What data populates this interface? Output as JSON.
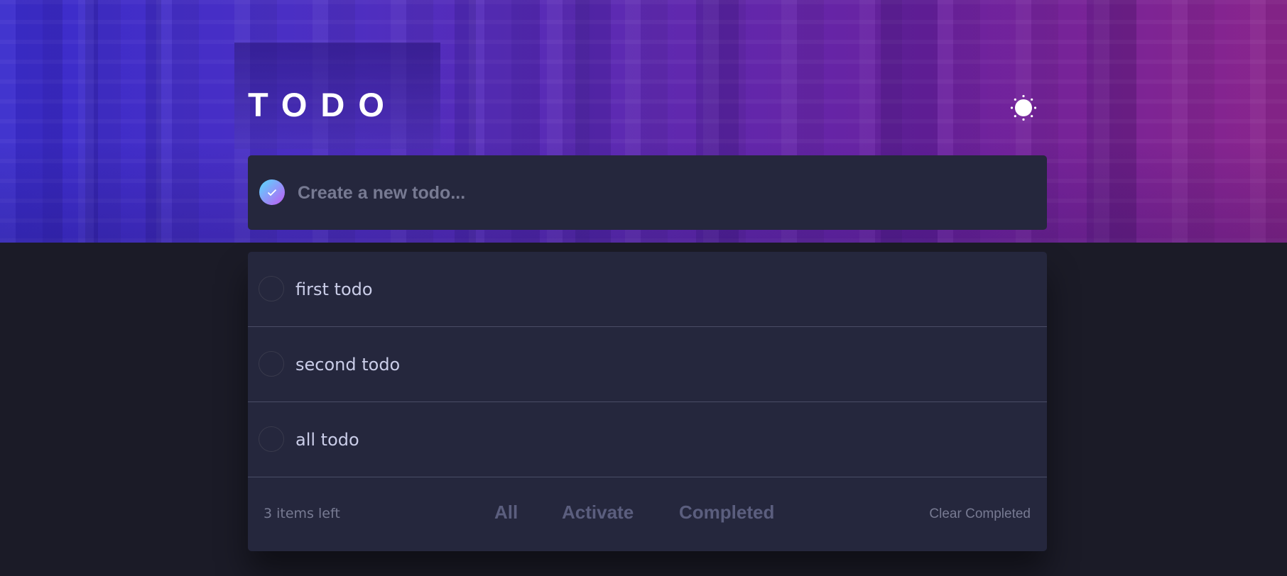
{
  "header": {
    "title": "TODO",
    "theme_toggle_icon": "sun-icon"
  },
  "new_todo": {
    "placeholder": "Create a new todo...",
    "value": "",
    "check_icon": "check-icon",
    "check_gradient": [
      "#57ddff",
      "#c058f3"
    ]
  },
  "todos": [
    {
      "label": "first todo",
      "completed": false
    },
    {
      "label": "second todo",
      "completed": false
    },
    {
      "label": "all todo",
      "completed": false
    }
  ],
  "footer": {
    "items_left": "3 items left",
    "filters": [
      "All",
      "Activate",
      "Completed"
    ],
    "clear_label": "Clear Completed"
  },
  "colors": {
    "page_bg": "#1b1b27",
    "card_bg": "#25273d",
    "text": "#cacde8",
    "muted": "#777a92",
    "filter": "#5b5e7e",
    "hero_left": "#3a2ccc",
    "hero_right": "#8a258c"
  }
}
